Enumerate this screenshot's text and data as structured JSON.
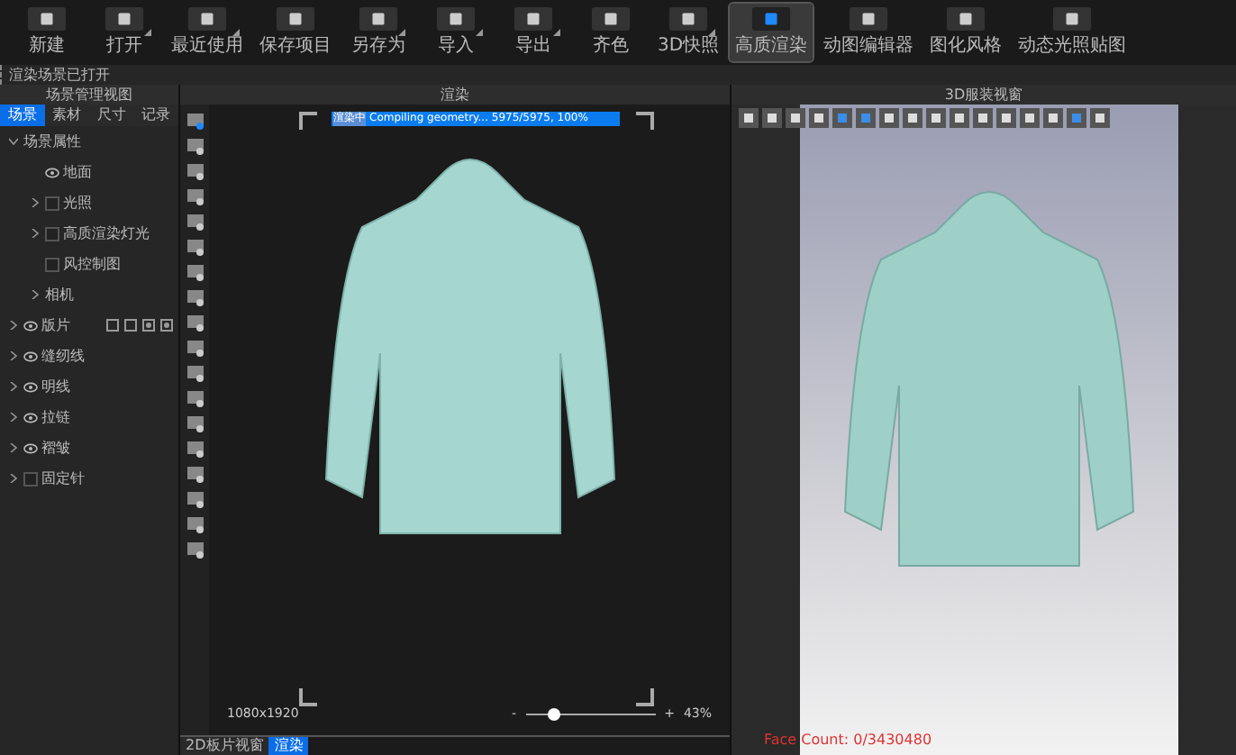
{
  "toolbar": [
    {
      "label": "新建",
      "selected": false,
      "menu": false
    },
    {
      "label": "打开",
      "selected": false,
      "menu": true
    },
    {
      "label": "最近使用",
      "selected": false,
      "menu": true
    },
    {
      "label": "保存项目",
      "selected": false,
      "menu": false
    },
    {
      "label": "另存为",
      "selected": false,
      "menu": true
    },
    {
      "label": "导入",
      "selected": false,
      "menu": true
    },
    {
      "label": "导出",
      "selected": false,
      "menu": true
    },
    {
      "label": "齐色",
      "selected": false,
      "menu": false
    },
    {
      "label": "3D快照",
      "selected": false,
      "menu": true
    },
    {
      "label": "高质渲染",
      "selected": true,
      "menu": false
    },
    {
      "label": "动图编辑器",
      "selected": false,
      "menu": false
    },
    {
      "label": "图化风格",
      "selected": false,
      "menu": false
    },
    {
      "label": "动态光照贴图",
      "selected": false,
      "menu": false
    }
  ],
  "status_line": "渲染场景已打开",
  "scene_panel": {
    "title": "场景管理视图",
    "tabs": [
      {
        "label": "场景",
        "selected": true
      },
      {
        "label": "素材",
        "selected": false
      },
      {
        "label": "尺寸",
        "selected": false
      },
      {
        "label": "记录",
        "selected": false
      }
    ],
    "tree": [
      {
        "label": "场景属性",
        "kind": "plain",
        "expanded": true,
        "children": [
          {
            "label": "地面",
            "kind": "eye"
          },
          {
            "label": "光照",
            "kind": "checkbox",
            "checked": false,
            "expanded": false
          },
          {
            "label": "高质渲染灯光",
            "kind": "checkbox",
            "checked": false,
            "expanded": false
          },
          {
            "label": "风控制图",
            "kind": "checkbox",
            "checked": false
          },
          {
            "label": "相机",
            "kind": "plain",
            "expanded": false
          }
        ]
      },
      {
        "label": "版片",
        "kind": "eye",
        "expanded": false,
        "tools": true
      },
      {
        "label": "缝纫线",
        "kind": "eye",
        "expanded": false
      },
      {
        "label": "明线",
        "kind": "eye",
        "expanded": false
      },
      {
        "label": "拉链",
        "kind": "eye",
        "expanded": false
      },
      {
        "label": "褶皱",
        "kind": "eye",
        "expanded": false
      },
      {
        "label": "固定针",
        "kind": "checkbox",
        "checked": false,
        "expanded": false
      }
    ]
  },
  "render_panel": {
    "title": "渲染",
    "progress_label": "渲染中",
    "progress_text": "Compiling geometry... 5975/5975, 100%",
    "progress": {
      "level": 1
    },
    "resolution": "1080x1920",
    "zoom_minus": "-",
    "zoom_plus": "+",
    "zoom": {
      "level": 0.22
    },
    "zoom_reading": "43%",
    "tabs": [
      {
        "label": "2D板片视窗",
        "selected": false
      },
      {
        "label": "渲染",
        "selected": true
      }
    ]
  },
  "view_panel": {
    "title": "3D服装视窗",
    "face_count": "Face Count: 0/3430480"
  }
}
